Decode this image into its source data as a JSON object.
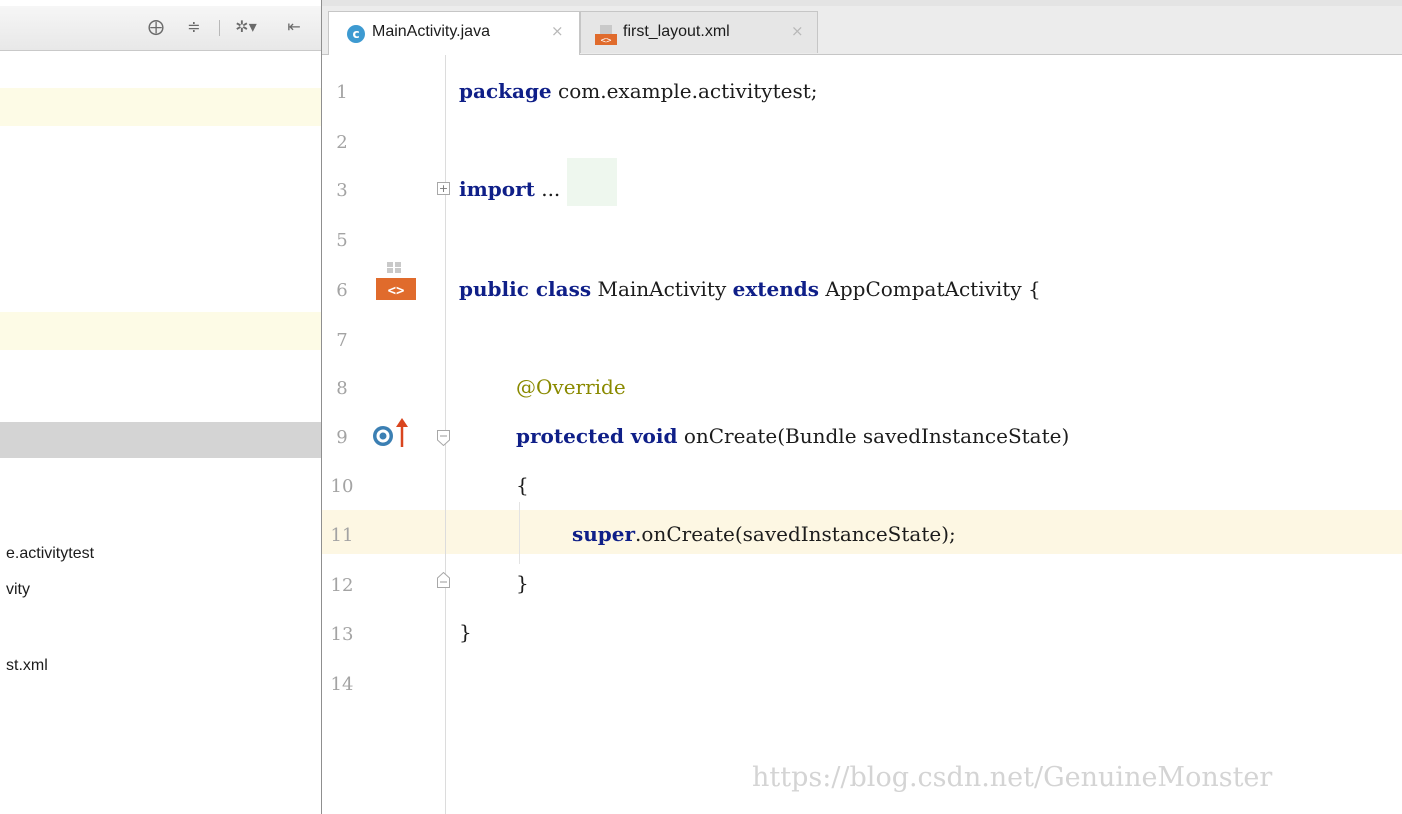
{
  "left_panel": {
    "toolbar_icons": [
      "target-icon",
      "collapse-icon",
      "gear-icon",
      "hide-icon"
    ],
    "tree_items": [
      "e.activitytest",
      "vity",
      "st.xml"
    ]
  },
  "tabs": [
    {
      "label": "MainActivity.java",
      "close": "×",
      "icon": "c",
      "active": true
    },
    {
      "label": "first_layout.xml",
      "close": "×",
      "icon": "xml-file-icon",
      "active": false
    }
  ],
  "editor": {
    "line_numbers": [
      "1",
      "2",
      "3",
      "5",
      "6",
      "7",
      "8",
      "9",
      "10",
      "11",
      "12",
      "13",
      "14"
    ],
    "lines": {
      "l1": {
        "kw": "package",
        "rest": " com.example.activitytest;"
      },
      "l3": {
        "kw": "import",
        "rest": " ..."
      },
      "l6": {
        "kw1": "public class",
        "mid": " MainActivity ",
        "kw2": "extends",
        "rest": " AppCompatActivity {"
      },
      "l8": {
        "anno": "@Override"
      },
      "l9": {
        "kw": "protected void",
        "rest": " onCreate(Bundle savedInstanceState)"
      },
      "l10": {
        "text": "{"
      },
      "l11": {
        "kw": "super",
        "rest": ".onCreate(savedInstanceState);"
      },
      "l12": {
        "text": "}"
      },
      "l13": {
        "text": "}"
      }
    },
    "gutter_icons": {
      "line6": "layout-file-icon",
      "line9": "override-method-icon",
      "line9_badge": "o"
    }
  },
  "watermark": "https://blog.csdn.net/GenuineMonster",
  "colors": {
    "keyword": "#0f1f88",
    "annotation": "#8a8a00",
    "current_line": "#fdf7e3",
    "row_highlight": "#fdfbe6",
    "selected_row": "#d4d4d4"
  }
}
